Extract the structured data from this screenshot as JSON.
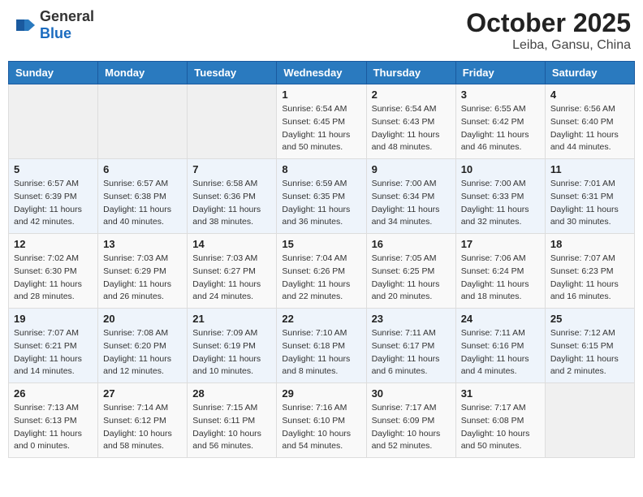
{
  "header": {
    "logo": {
      "general": "General",
      "blue": "Blue"
    },
    "title": "October 2025",
    "subtitle": "Leiba, Gansu, China"
  },
  "days_of_week": [
    "Sunday",
    "Monday",
    "Tuesday",
    "Wednesday",
    "Thursday",
    "Friday",
    "Saturday"
  ],
  "weeks": [
    {
      "days": [
        {
          "number": "",
          "info": ""
        },
        {
          "number": "",
          "info": ""
        },
        {
          "number": "",
          "info": ""
        },
        {
          "number": "1",
          "info": "Sunrise: 6:54 AM\nSunset: 6:45 PM\nDaylight: 11 hours\nand 50 minutes."
        },
        {
          "number": "2",
          "info": "Sunrise: 6:54 AM\nSunset: 6:43 PM\nDaylight: 11 hours\nand 48 minutes."
        },
        {
          "number": "3",
          "info": "Sunrise: 6:55 AM\nSunset: 6:42 PM\nDaylight: 11 hours\nand 46 minutes."
        },
        {
          "number": "4",
          "info": "Sunrise: 6:56 AM\nSunset: 6:40 PM\nDaylight: 11 hours\nand 44 minutes."
        }
      ]
    },
    {
      "days": [
        {
          "number": "5",
          "info": "Sunrise: 6:57 AM\nSunset: 6:39 PM\nDaylight: 11 hours\nand 42 minutes."
        },
        {
          "number": "6",
          "info": "Sunrise: 6:57 AM\nSunset: 6:38 PM\nDaylight: 11 hours\nand 40 minutes."
        },
        {
          "number": "7",
          "info": "Sunrise: 6:58 AM\nSunset: 6:36 PM\nDaylight: 11 hours\nand 38 minutes."
        },
        {
          "number": "8",
          "info": "Sunrise: 6:59 AM\nSunset: 6:35 PM\nDaylight: 11 hours\nand 36 minutes."
        },
        {
          "number": "9",
          "info": "Sunrise: 7:00 AM\nSunset: 6:34 PM\nDaylight: 11 hours\nand 34 minutes."
        },
        {
          "number": "10",
          "info": "Sunrise: 7:00 AM\nSunset: 6:33 PM\nDaylight: 11 hours\nand 32 minutes."
        },
        {
          "number": "11",
          "info": "Sunrise: 7:01 AM\nSunset: 6:31 PM\nDaylight: 11 hours\nand 30 minutes."
        }
      ]
    },
    {
      "days": [
        {
          "number": "12",
          "info": "Sunrise: 7:02 AM\nSunset: 6:30 PM\nDaylight: 11 hours\nand 28 minutes."
        },
        {
          "number": "13",
          "info": "Sunrise: 7:03 AM\nSunset: 6:29 PM\nDaylight: 11 hours\nand 26 minutes."
        },
        {
          "number": "14",
          "info": "Sunrise: 7:03 AM\nSunset: 6:27 PM\nDaylight: 11 hours\nand 24 minutes."
        },
        {
          "number": "15",
          "info": "Sunrise: 7:04 AM\nSunset: 6:26 PM\nDaylight: 11 hours\nand 22 minutes."
        },
        {
          "number": "16",
          "info": "Sunrise: 7:05 AM\nSunset: 6:25 PM\nDaylight: 11 hours\nand 20 minutes."
        },
        {
          "number": "17",
          "info": "Sunrise: 7:06 AM\nSunset: 6:24 PM\nDaylight: 11 hours\nand 18 minutes."
        },
        {
          "number": "18",
          "info": "Sunrise: 7:07 AM\nSunset: 6:23 PM\nDaylight: 11 hours\nand 16 minutes."
        }
      ]
    },
    {
      "days": [
        {
          "number": "19",
          "info": "Sunrise: 7:07 AM\nSunset: 6:21 PM\nDaylight: 11 hours\nand 14 minutes."
        },
        {
          "number": "20",
          "info": "Sunrise: 7:08 AM\nSunset: 6:20 PM\nDaylight: 11 hours\nand 12 minutes."
        },
        {
          "number": "21",
          "info": "Sunrise: 7:09 AM\nSunset: 6:19 PM\nDaylight: 11 hours\nand 10 minutes."
        },
        {
          "number": "22",
          "info": "Sunrise: 7:10 AM\nSunset: 6:18 PM\nDaylight: 11 hours\nand 8 minutes."
        },
        {
          "number": "23",
          "info": "Sunrise: 7:11 AM\nSunset: 6:17 PM\nDaylight: 11 hours\nand 6 minutes."
        },
        {
          "number": "24",
          "info": "Sunrise: 7:11 AM\nSunset: 6:16 PM\nDaylight: 11 hours\nand 4 minutes."
        },
        {
          "number": "25",
          "info": "Sunrise: 7:12 AM\nSunset: 6:15 PM\nDaylight: 11 hours\nand 2 minutes."
        }
      ]
    },
    {
      "days": [
        {
          "number": "26",
          "info": "Sunrise: 7:13 AM\nSunset: 6:13 PM\nDaylight: 11 hours\nand 0 minutes."
        },
        {
          "number": "27",
          "info": "Sunrise: 7:14 AM\nSunset: 6:12 PM\nDaylight: 10 hours\nand 58 minutes."
        },
        {
          "number": "28",
          "info": "Sunrise: 7:15 AM\nSunset: 6:11 PM\nDaylight: 10 hours\nand 56 minutes."
        },
        {
          "number": "29",
          "info": "Sunrise: 7:16 AM\nSunset: 6:10 PM\nDaylight: 10 hours\nand 54 minutes."
        },
        {
          "number": "30",
          "info": "Sunrise: 7:17 AM\nSunset: 6:09 PM\nDaylight: 10 hours\nand 52 minutes."
        },
        {
          "number": "31",
          "info": "Sunrise: 7:17 AM\nSunset: 6:08 PM\nDaylight: 10 hours\nand 50 minutes."
        },
        {
          "number": "",
          "info": ""
        }
      ]
    }
  ]
}
